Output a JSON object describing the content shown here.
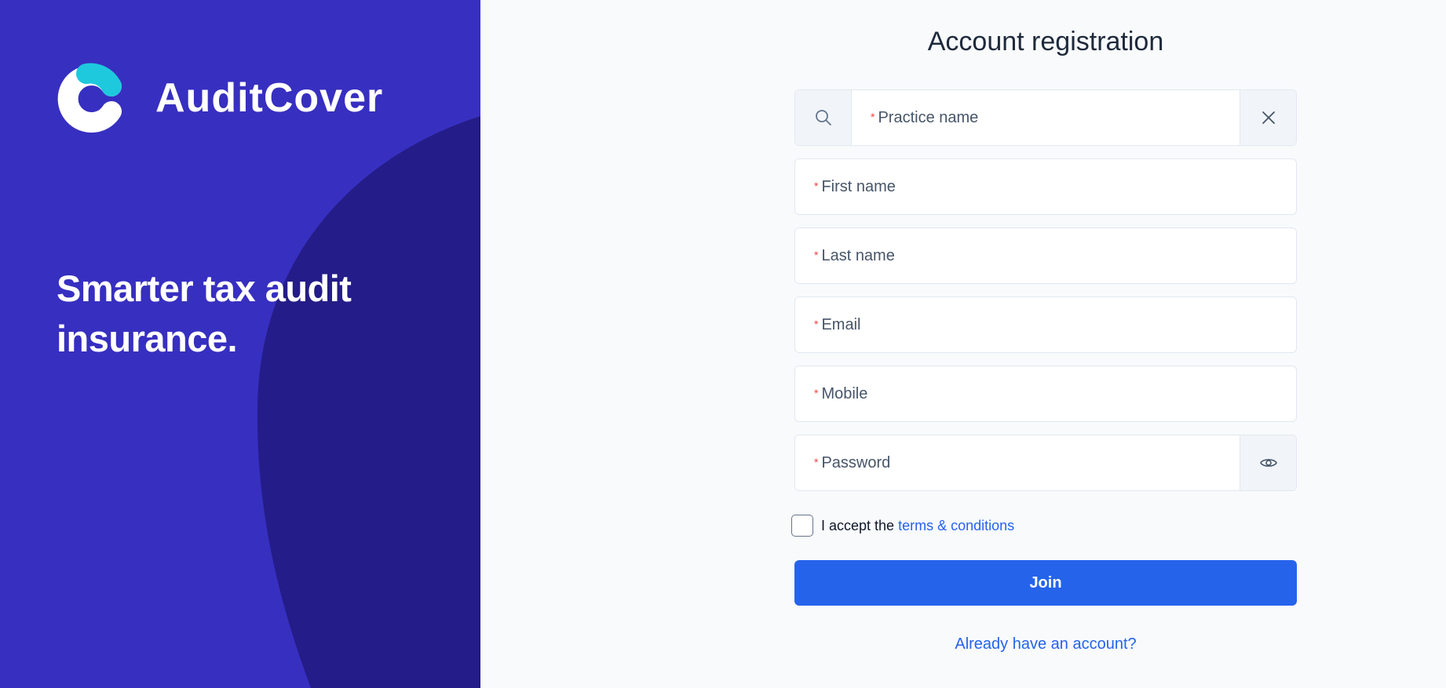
{
  "brand": {
    "name": "AuditCover",
    "tagline": "Smarter tax audit insurance.",
    "colors": {
      "panel": "#372fc0",
      "panel_shape": "#241c88",
      "logo_accent": "#1ec9dd",
      "primary": "#2563eb"
    }
  },
  "form": {
    "title": "Account registration",
    "required_marker": "*",
    "fields": {
      "practice_name": {
        "placeholder": "Practice name",
        "left_icon": "search-icon",
        "right_icon": "close-icon"
      },
      "first_name": {
        "placeholder": "First name"
      },
      "last_name": {
        "placeholder": "Last name"
      },
      "email": {
        "placeholder": "Email"
      },
      "mobile": {
        "placeholder": "Mobile"
      },
      "password": {
        "placeholder": "Password",
        "right_icon": "eye-icon"
      }
    },
    "terms": {
      "prefix": "I accept the ",
      "link_text": "terms & conditions",
      "checked": false
    },
    "submit_label": "Join",
    "login_link": "Already have an account?"
  }
}
